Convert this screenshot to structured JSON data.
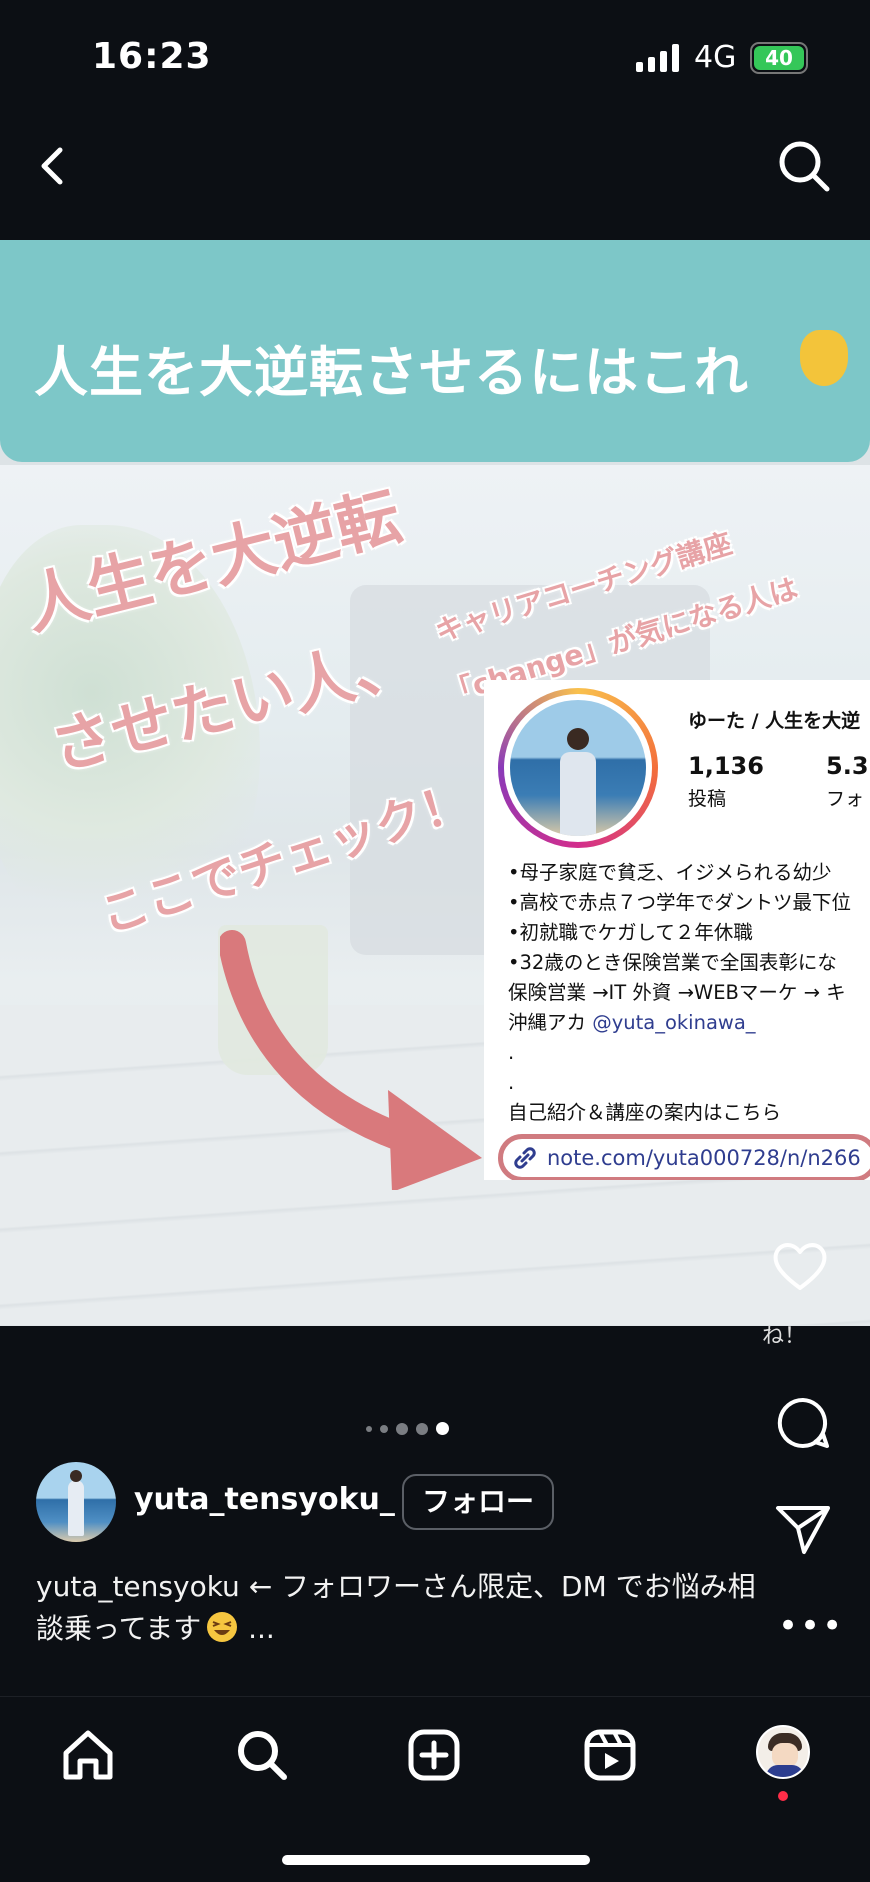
{
  "status_bar": {
    "time": "16:23",
    "network": "4G",
    "battery": "40"
  },
  "post_image": {
    "banner_title": "人生を大逆転させるにはこれ",
    "overlay_line1": "人生を大逆転",
    "overlay_line2": "させたい人、",
    "overlay_line3": "ここでチェック！",
    "overlay_small1": "キャリアコーチング講座",
    "overlay_small2": "「change」が気になる人は",
    "profile_card": {
      "name": "ゆーた / 人生を大逆",
      "posts_count": "1,136",
      "posts_label": "投稿",
      "followers_count": "5.3",
      "followers_label": "フォ",
      "bio_lines": [
        "•母子家庭で貧乏、イジメられる幼少",
        "•高校で赤点７つ学年でダントツ最下位",
        "•初就職でケガして２年休職",
        "•32歳のとき保険営業で全国表彰にな",
        "保険営業 →IT 外資 →WEBマーケ → キ"
      ],
      "bio_account_prefix": "沖縄アカ ",
      "bio_mention": "@yuta_okinawa_",
      "bio_dot1": ".",
      "bio_dot2": ".",
      "bio_intro": "自己紹介＆講座の案内はこちら",
      "link": "note.com/yuta000728/n/n266"
    }
  },
  "actions": {
    "like_caption": "ね！"
  },
  "carousel": {
    "count": 5,
    "active_index": 4
  },
  "author": {
    "username": "yuta_tensyoku_",
    "follow_label": "フォロー"
  },
  "caption": {
    "text": "yuta_tensyoku ← フォロワーさん限定、DM でお悩み相談乗ってます",
    "more": " ..."
  },
  "tabbar": {
    "items": [
      "home-icon",
      "search-icon",
      "create-icon",
      "reels-icon",
      "profile-avatar"
    ]
  },
  "colors": {
    "banner": "#7dc7c8",
    "overlay_pink": "#e7a3a6",
    "link_blue": "#2f3d8f",
    "notification": "#ff2d48"
  }
}
